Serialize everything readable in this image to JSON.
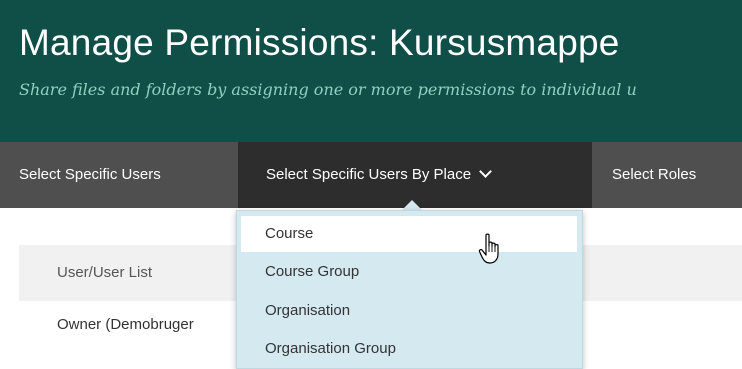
{
  "header": {
    "title": "Manage Permissions: Kursusmappe",
    "subtitle": "Share files and folders by assigning one or more permissions to individual u"
  },
  "tabs": [
    {
      "label": "Select Specific Users"
    },
    {
      "label": "Select Specific Users By Place",
      "icon": "chevron-down-icon",
      "active": true
    },
    {
      "label": "Select Roles"
    }
  ],
  "table": {
    "header_label": "User/User List",
    "rows": [
      {
        "label": "Owner (Demobruger"
      }
    ]
  },
  "dropdown": {
    "items": [
      {
        "label": "Course",
        "highlighted": true
      },
      {
        "label": "Course Group"
      },
      {
        "label": "Organisation"
      },
      {
        "label": "Organisation Group"
      }
    ]
  },
  "colors": {
    "header_bg": "#0f4f48",
    "subtitle": "#8fd0bf",
    "tabbar_bg": "#4f4f4f",
    "active_tab_bg": "#2d2d2d",
    "dropdown_bg": "#d5e9f0",
    "table_head_bg": "#f1f1f1"
  },
  "cursor": "hand-pointer-icon"
}
